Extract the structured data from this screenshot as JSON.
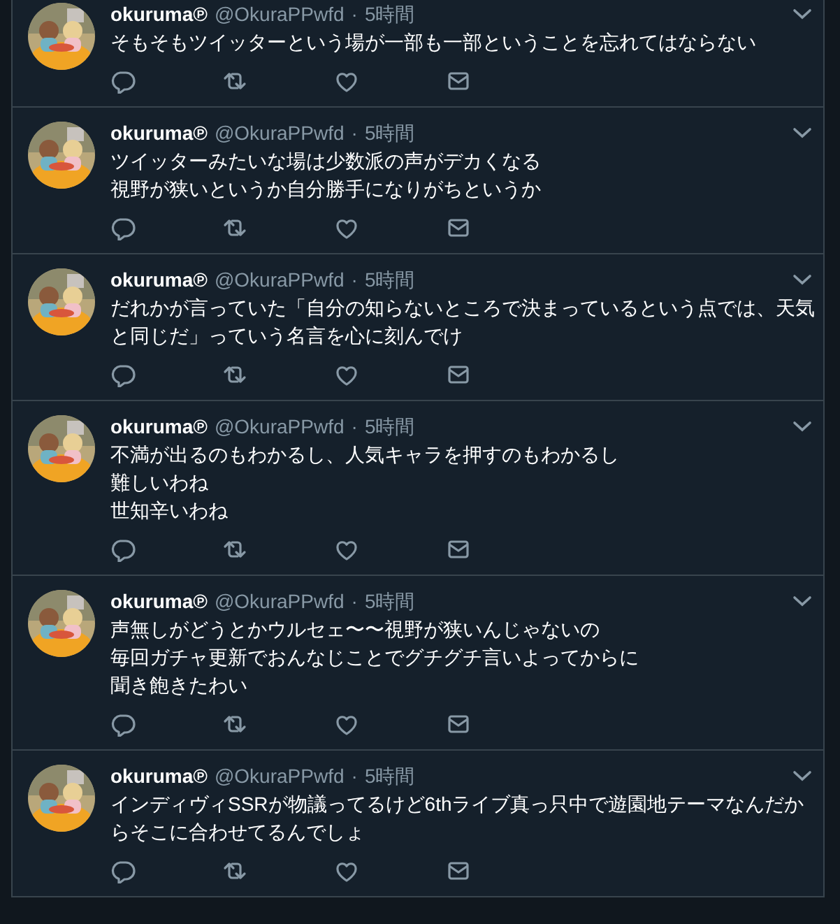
{
  "tweets": [
    {
      "name": "okuruma℗",
      "handle": "@OkuraPPwfd",
      "separator": "·",
      "time": "5時間",
      "lines": [
        "そもそもツイッターという場が一部も一部ということを忘れてはならない"
      ]
    },
    {
      "name": "okuruma℗",
      "handle": "@OkuraPPwfd",
      "separator": "·",
      "time": "5時間",
      "lines": [
        "ツイッターみたいな場は少数派の声がデカくなる",
        "視野が狭いというか自分勝手になりがちというか"
      ]
    },
    {
      "name": "okuruma℗",
      "handle": "@OkuraPPwfd",
      "separator": "·",
      "time": "5時間",
      "lines": [
        "だれかが言っていた「自分の知らないところで決まっているという点では、天気と同じだ」っていう名言を心に刻んでけ"
      ]
    },
    {
      "name": "okuruma℗",
      "handle": "@OkuraPPwfd",
      "separator": "·",
      "time": "5時間",
      "lines": [
        "不満が出るのもわかるし、人気キャラを押すのもわかるし",
        "難しいわね",
        "世知辛いわね"
      ]
    },
    {
      "name": "okuruma℗",
      "handle": "@OkuraPPwfd",
      "separator": "·",
      "time": "5時間",
      "lines": [
        "声無しがどうとかウルセェ〜〜視野が狭いんじゃないの",
        "毎回ガチャ更新でおんなじことでグチグチ言いよってからに",
        "聞き飽きたわい"
      ]
    },
    {
      "name": "okuruma℗",
      "handle": "@OkuraPPwfd",
      "separator": "·",
      "time": "5時間",
      "lines": [
        "インディヴィSSRが物議ってるけど6thライブ真っ只中で遊園地テーマなんだからそこに合わせてるんでしょ"
      ]
    }
  ]
}
